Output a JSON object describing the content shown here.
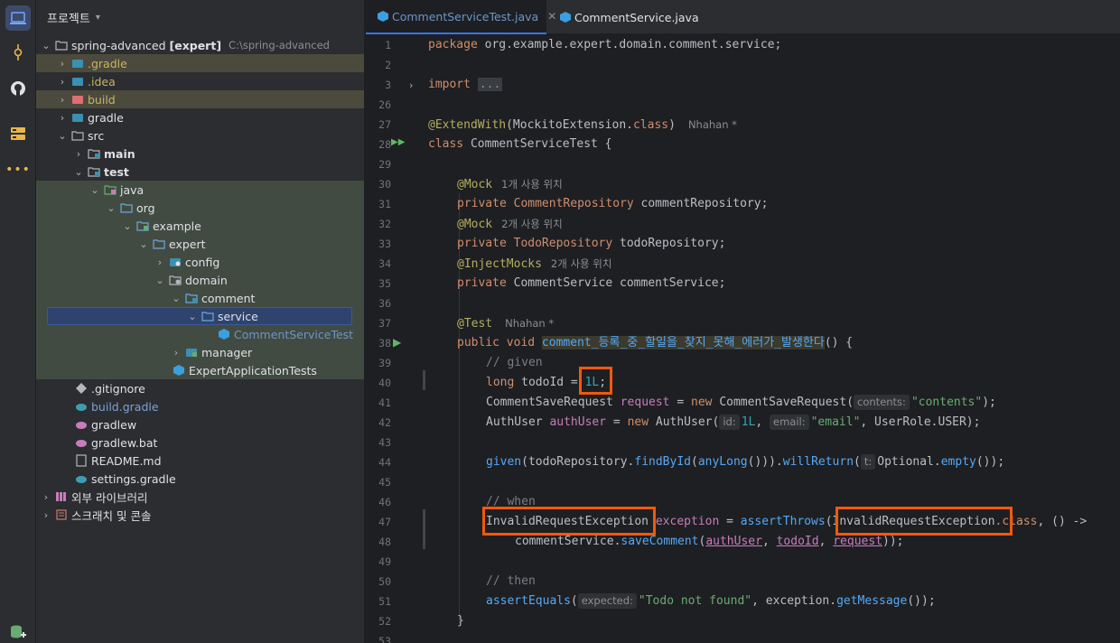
{
  "project_panel": {
    "title": "프로젝트",
    "tree": [
      {
        "label": "spring-advanced",
        "badge": "[expert]",
        "path": "C:\\spring-advanced"
      },
      {
        "label": ".gradle"
      },
      {
        "label": ".idea"
      },
      {
        "label": "build"
      },
      {
        "label": "gradle"
      },
      {
        "label": "src"
      },
      {
        "label": "main"
      },
      {
        "label": "test"
      },
      {
        "label": "java"
      },
      {
        "label": "org"
      },
      {
        "label": "example"
      },
      {
        "label": "expert"
      },
      {
        "label": "config"
      },
      {
        "label": "domain"
      },
      {
        "label": "comment"
      },
      {
        "label": "service"
      },
      {
        "label": "CommentServiceTest"
      },
      {
        "label": "manager"
      },
      {
        "label": "ExpertApplicationTests"
      },
      {
        "label": ".gitignore"
      },
      {
        "label": "build.gradle"
      },
      {
        "label": "gradlew"
      },
      {
        "label": "gradlew.bat"
      },
      {
        "label": "README.md"
      },
      {
        "label": "settings.gradle"
      },
      {
        "label": "외부 라이브러리"
      },
      {
        "label": "스크래치 및 콘솔"
      }
    ]
  },
  "tabs": [
    {
      "label": "CommentServiceTest.java",
      "active": true
    },
    {
      "label": "CommentService.java",
      "active": false
    }
  ],
  "editor": {
    "line_numbers": [
      "1",
      "2",
      "3",
      "26",
      "27",
      "28",
      "29",
      "30",
      "31",
      "32",
      "33",
      "34",
      "35",
      "36",
      "37",
      "38",
      "39",
      "40",
      "41",
      "42",
      "43",
      "44",
      "45",
      "46",
      "47",
      "48",
      "49",
      "50",
      "51",
      "52",
      "53"
    ],
    "package_kw": "package",
    "package_name": "org.example.expert.domain.comment.service;",
    "import_kw": "import",
    "import_fold": "...",
    "ann_extend": "@ExtendWith",
    "extend_arg": "(MockitoExtension.",
    "class_kw": "class",
    "extend_close": ")",
    "author": "Nhahan *",
    "class_decl": "CommentServiceTest {",
    "ann_mock": "@Mock",
    "usage_1": "1개 사용 위치",
    "usage_2": "2개 사용 위치",
    "private_kw": "private",
    "repo_type": "CommentRepository",
    "repo_var": "commentRepository;",
    "todo_repo_type": "TodoRepository",
    "todo_repo_var": "todoRepository;",
    "ann_inject": "@InjectMocks",
    "service_decl": "CommentService commentService;",
    "ann_test": "@Test",
    "public_void": "public void",
    "method_name": "comment_등록_중_할일을_찾지_못해_에러가_발생한다",
    "method_tail": "() {",
    "comment_given": "// given",
    "long_kw": "long",
    "todo_id_decl": "todoId = ",
    "todo_id_val": "1L",
    "semi": ";",
    "req_type": "CommentSaveRequest",
    "req_var": "request",
    "new_kw": "new",
    "req_ctor": "CommentSaveRequest(",
    "hint_contents": "contents:",
    "str_contents": "\"contents\"",
    "close_paren_semi": ");",
    "authuser_type": "AuthUser",
    "authuser_var": "authUser",
    "authuser_ctor": "AuthUser(",
    "hint_id": "id:",
    "num_1l": "1L",
    "hint_email": "email:",
    "str_email": "\"email\"",
    "role": ", UserRole.USER);",
    "given_call": "given",
    "given_arg": "(todoRepository.",
    "find_by_id": "findById",
    "any_long": "anyLong",
    "will_return": "willReturn",
    "hint_t": "t:",
    "optional_empty": "Optional.",
    "empty_fn": "empty",
    "comment_when": "// when",
    "exception_type": "InvalidRequestException",
    "exception_var": "exception",
    "assert_throws": "assertThrows",
    "class_suffix": ".class",
    "lambda": ", () ->",
    "service_call": "commentService.",
    "save_comment": "saveComment",
    "arg_authuser": "authUser",
    "arg_todoid": "todoId",
    "arg_request": "request",
    "comment_then": "// then",
    "assert_equals": "assertEquals",
    "hint_expected": "expected:",
    "str_not_found": "\"Todo not found\"",
    "exception_ref": "exception.",
    "get_message": "getMessage",
    "closing_brace": "}"
  },
  "colors": {
    "accent": "#3574f0",
    "highlight_box": "#f2580c"
  }
}
